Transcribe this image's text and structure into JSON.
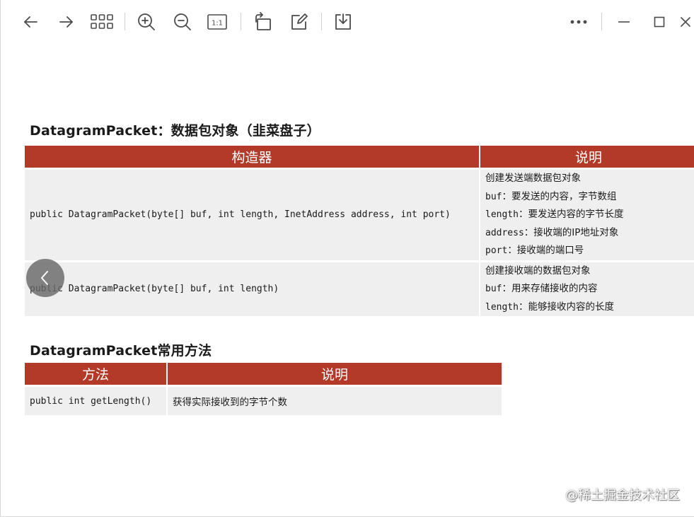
{
  "toolbar": {
    "icons": [
      "back-arrow-icon",
      "forward-arrow-icon",
      "grid-view-icon",
      "zoom-in-icon",
      "zoom-out-icon",
      "actual-size-icon",
      "rotate-icon",
      "edit-icon",
      "download-icon",
      "more-icon",
      "minimize-icon",
      "maximize-icon",
      "close-icon"
    ],
    "actual_size_label": "1:1"
  },
  "section1": {
    "title": "DatagramPacket：数据包对象（韭菜盘子）",
    "headers": [
      "构造器",
      "说明"
    ],
    "rows": [
      {
        "constructor": "public DatagramPacket(byte[] buf, int length, InetAddress address, int port)",
        "desc": [
          {
            "kw": "",
            "text": "创建发送端数据包对象"
          },
          {
            "kw": "buf",
            "text": "：要发送的内容，字节数组"
          },
          {
            "kw": "length",
            "text": "：要发送内容的字节长度"
          },
          {
            "kw": "address",
            "text": "：接收端的IP地址对象"
          },
          {
            "kw": "port",
            "text": "：接收端的端口号"
          }
        ]
      },
      {
        "constructor": "public DatagramPacket(byte[] buf, int length)",
        "desc": [
          {
            "kw": "",
            "text": "创建接收端的数据包对象"
          },
          {
            "kw": "buf",
            "text": "：用来存储接收的内容"
          },
          {
            "kw": "length",
            "text": "：能够接收内容的长度"
          }
        ]
      }
    ]
  },
  "section2": {
    "title": "DatagramPacket常用方法",
    "headers": [
      "方法",
      "说明"
    ],
    "rows": [
      {
        "method": "public int getLength()",
        "desc": "获得实际接收到的字节个数"
      }
    ]
  },
  "watermark": "@稀土掘金技术社区",
  "colors": {
    "header_bg": "#b33a29",
    "cell_bg": "#efefef",
    "icon": "#4a4a4a"
  }
}
